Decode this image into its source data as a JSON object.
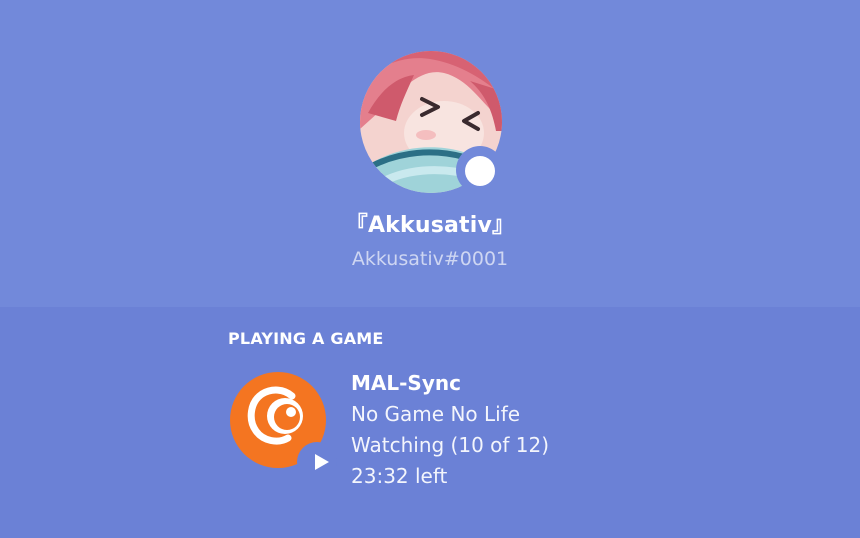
{
  "profile": {
    "display_name": "『Akkusativ』",
    "tag": "Akkusativ#0001",
    "avatar_icon": "anime-avatar",
    "status": "online",
    "status_color": "#ffffff"
  },
  "activity": {
    "section_title": "PLAYING A GAME",
    "app_icon": "crunchyroll-icon",
    "app_icon_color": "#f47521",
    "small_icon": "play-icon",
    "app_name": "MAL-Sync",
    "details": "No Game No Life",
    "state": "Watching (10 of 12)",
    "time_left": "23:32 left"
  },
  "colors": {
    "background": "#7289da",
    "activity_background": "#6b81d6"
  }
}
